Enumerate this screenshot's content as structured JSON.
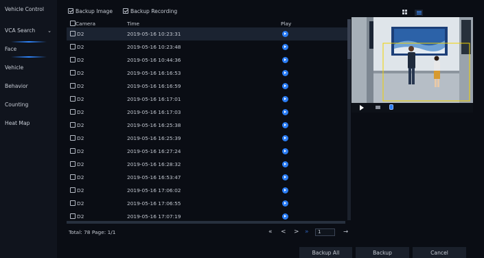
{
  "sidebar": {
    "items": [
      {
        "label": "Vehicle Control"
      },
      {
        "label": "VCA Search",
        "chevron": "⌄"
      },
      {
        "label": "Face"
      },
      {
        "label": "Vehicle"
      },
      {
        "label": "Behavior"
      },
      {
        "label": "Counting"
      },
      {
        "label": "Heat Map"
      }
    ]
  },
  "options": {
    "backup_image": {
      "label": "Backup Image",
      "checked": true
    },
    "backup_recording": {
      "label": "Backup Recording",
      "checked": true
    }
  },
  "view_toggle": {
    "grid_icon": "grid-view-icon",
    "list_icon": "list-view-icon",
    "active": "list"
  },
  "table": {
    "columns": {
      "camera": "Camera",
      "time": "Time",
      "play": "Play"
    },
    "rows": [
      {
        "camera": "D2",
        "time": "2019-05-16 10:23:31",
        "selected": true
      },
      {
        "camera": "D2",
        "time": "2019-05-16 10:23:48"
      },
      {
        "camera": "D2",
        "time": "2019-05-16 10:44:36"
      },
      {
        "camera": "D2",
        "time": "2019-05-16 16:16:53"
      },
      {
        "camera": "D2",
        "time": "2019-05-16 16:16:59"
      },
      {
        "camera": "D2",
        "time": "2019-05-16 16:17:01"
      },
      {
        "camera": "D2",
        "time": "2019-05-16 16:17:03"
      },
      {
        "camera": "D2",
        "time": "2019-05-16 16:25:38"
      },
      {
        "camera": "D2",
        "time": "2019-05-16 16:25:39"
      },
      {
        "camera": "D2",
        "time": "2019-05-16 16:27:24"
      },
      {
        "camera": "D2",
        "time": "2019-05-16 16:28:32"
      },
      {
        "camera": "D2",
        "time": "2019-05-16 16:53:47"
      },
      {
        "camera": "D2",
        "time": "2019-05-16 17:06:02"
      },
      {
        "camera": "D2",
        "time": "2019-05-16 17:06:55"
      },
      {
        "camera": "D2",
        "time": "2019-05-16 17:07:19"
      }
    ]
  },
  "pagination": {
    "summary": "Total: 78  Page: 1/1",
    "first": "«",
    "prev": "<",
    "next": ">",
    "last": "»",
    "page_value": "1",
    "go": "→"
  },
  "footer": {
    "backup_all": "Backup All",
    "backup": "Backup",
    "cancel": "Cancel"
  },
  "preview": {
    "controls": [
      "play-icon",
      "stop-icon",
      "snapshot-icon"
    ]
  },
  "colors": {
    "accent": "#2a7cf4",
    "background": "#0a0d14",
    "sidebar": "#10141d",
    "detection_box": "#f0d200"
  }
}
